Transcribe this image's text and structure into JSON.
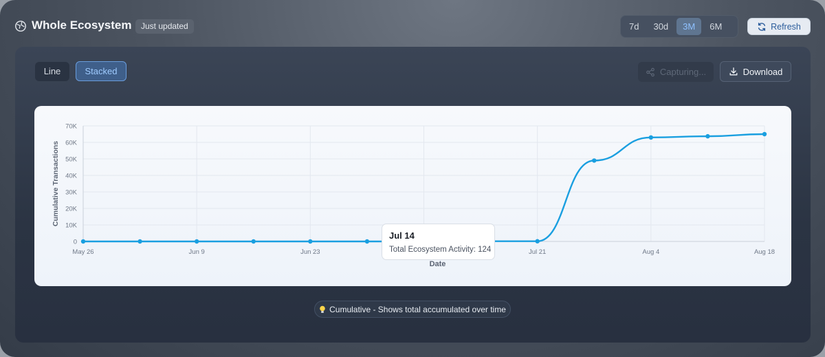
{
  "header": {
    "title": "Whole Ecosystem",
    "badge": "Just updated",
    "ranges": [
      "7d",
      "30d",
      "3M",
      "6M"
    ],
    "active_range": "3M",
    "refresh_label": "Refresh",
    "logo_icon": "globe-icon",
    "refresh_icon": "refresh-icon"
  },
  "toolbar": {
    "line_label": "Line",
    "stacked_label": "Stacked",
    "capture_label": "Capturing...",
    "download_label": "Download",
    "capture_icon": "share-icon",
    "download_icon": "download-icon"
  },
  "colors": {
    "accent": "#1a9fe0",
    "active_text": "#8fc1ff"
  },
  "chart_data": {
    "type": "line",
    "xlabel": "Date",
    "ylabel": "Cumulative Transactions",
    "ylim": [
      0,
      70000
    ],
    "y_ticks": [
      0,
      10000,
      20000,
      30000,
      40000,
      50000,
      60000,
      70000
    ],
    "y_tick_labels": [
      "0",
      "10K",
      "20K",
      "30K",
      "40K",
      "50K",
      "60K",
      "70K"
    ],
    "x_tick_labels": [
      "May 26",
      "Jun 9",
      "Jun 23",
      "Jul 21",
      "Aug 4",
      "Aug 18"
    ],
    "x_tick_dates": [
      "2024-05-26",
      "2024-06-09",
      "2024-06-23",
      "2024-07-21",
      "2024-08-04",
      "2024-08-18"
    ],
    "grid": true,
    "series": [
      {
        "color": "#1a9fe0",
        "points": [
          {
            "x": "2024-05-26",
            "y": 0
          },
          {
            "x": "2024-06-02",
            "y": 0
          },
          {
            "x": "2024-06-09",
            "y": 0
          },
          {
            "x": "2024-06-16",
            "y": 0
          },
          {
            "x": "2024-06-23",
            "y": 0
          },
          {
            "x": "2024-06-30",
            "y": 0
          },
          {
            "x": "2024-07-07",
            "y": 0
          },
          {
            "x": "2024-07-14",
            "y": 124
          },
          {
            "x": "2024-07-21",
            "y": 124
          },
          {
            "x": "2024-07-28",
            "y": 49000
          },
          {
            "x": "2024-08-04",
            "y": 63000
          },
          {
            "x": "2024-08-11",
            "y": 63700
          },
          {
            "x": "2024-08-18",
            "y": 65000
          }
        ]
      }
    ],
    "tooltip": {
      "date": "Jul 14",
      "text": "Total Ecosystem Activity: 124"
    }
  },
  "footer": {
    "hint": "Cumulative - Shows total accumulated over time",
    "hint_icon": "lightbulb-icon"
  }
}
